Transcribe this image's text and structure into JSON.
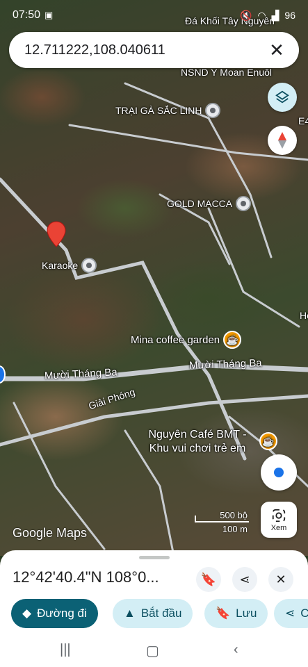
{
  "status_bar": {
    "time": "07:50",
    "icons": [
      "photo-icon",
      "mute-icon",
      "wifi-icon",
      "volte-icon",
      "signal-icon",
      "battery-icon"
    ],
    "battery": "96"
  },
  "search": {
    "value": "12.711222,108.040611"
  },
  "map": {
    "places": [
      {
        "name": "Đá Khối Tây Nguyên",
        "type": "poi"
      },
      {
        "name": "NSND Y Moan Enuôl",
        "type": "poi"
      },
      {
        "name": "TRẠI GÀ SẮC LINH",
        "type": "poi"
      },
      {
        "name": "GOLD MACCA",
        "type": "poi"
      },
      {
        "name": "Karaoke",
        "type": "poi"
      },
      {
        "name": "Mina coffee garden",
        "type": "cafe"
      },
      {
        "name": "Nguyên Café BMT - Khu vui chơi trẻ em",
        "type": "cafe"
      }
    ],
    "roads": [
      "Mười Tháng Ba",
      "Mười Tháng Ba",
      "Giải Phóng"
    ],
    "edge_labels": [
      "E4",
      "Hơ"
    ],
    "attribution": "Google Maps",
    "scale": {
      "top": "500 bộ",
      "bottom": "100 m"
    },
    "pin_color": "#ea4335",
    "road_color": "#c8ccd0"
  },
  "controls": {
    "layers_icon": "layers-icon",
    "compass_icon": "compass-icon",
    "my_location_icon": "my-location-icon",
    "lens_label": "Xem"
  },
  "sheet": {
    "title": "12°42'40.4\"N 108°0...",
    "chips": [
      {
        "label": "Đường đi",
        "icon": "directions-icon"
      },
      {
        "label": "Bắt đầu",
        "icon": "navigation-icon"
      },
      {
        "label": "Lưu",
        "icon": "bookmark-icon"
      },
      {
        "label": "C",
        "icon": "share-icon"
      }
    ]
  },
  "colors": {
    "accent": "#0b6175",
    "chip_bg": "#d3eef5"
  }
}
